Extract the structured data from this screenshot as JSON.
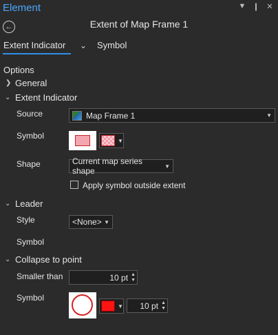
{
  "pane": {
    "title": "Element"
  },
  "titlebar": {
    "icons": [
      "chevron-down-icon",
      "pin-icon",
      "close-icon"
    ]
  },
  "panel": {
    "title": "Extent of Map Frame 1"
  },
  "tabs": [
    {
      "label": "Extent Indicator",
      "active": true
    },
    {
      "label": "Symbol",
      "active": false
    }
  ],
  "options": {
    "heading": "Options",
    "general": {
      "label": "General",
      "expanded": false
    },
    "extent_indicator": {
      "label": "Extent Indicator",
      "expanded": true,
      "source_label": "Source",
      "source_value": "Map Frame 1",
      "symbol_label": "Symbol",
      "shape_label": "Shape",
      "shape_value": "Current map series shape",
      "apply_label": "Apply symbol outside extent",
      "apply_checked": false
    },
    "leader": {
      "label": "Leader",
      "expanded": true,
      "style_label": "Style",
      "style_value": "<None>",
      "symbol_label": "Symbol"
    },
    "collapse": {
      "label": "Collapse to point",
      "expanded": true,
      "smaller_label": "Smaller than",
      "smaller_value": "10 pt",
      "symbol_label": "Symbol",
      "size_value": "10 pt"
    }
  },
  "colors": {
    "accent": "#2f8fe8",
    "title": "#4aa8ff",
    "extent_fill": "#f4a6b0",
    "extent_outline": "#c4242b",
    "collapse_color": "#ff1414"
  }
}
